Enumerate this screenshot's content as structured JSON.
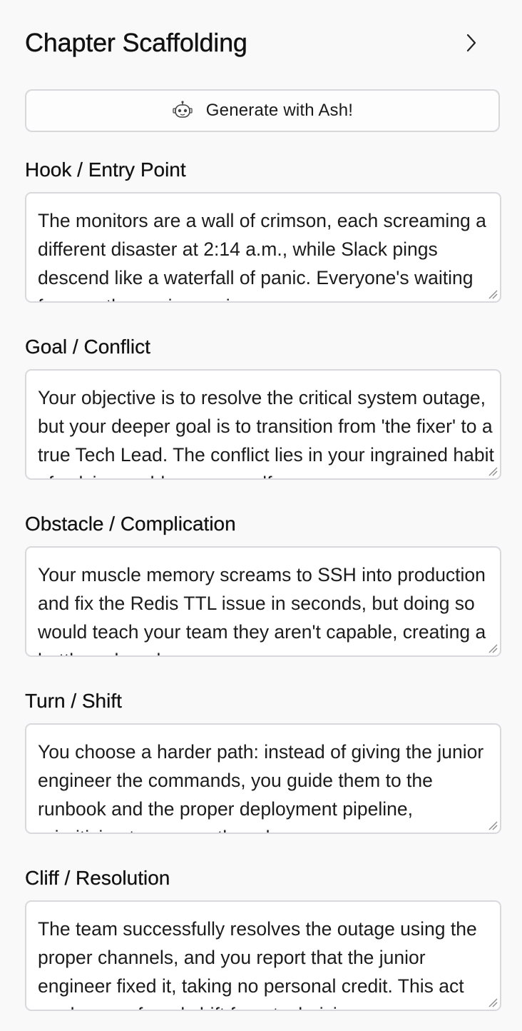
{
  "panel": {
    "title": "Chapter Scaffolding",
    "chevron_icon": "chevron-right-icon",
    "generate_button": {
      "label": "Generate with Ash!",
      "icon": "robot-icon"
    }
  },
  "sections": [
    {
      "label": "Hook / Entry Point",
      "value": "The monitors are a wall of crimson, each screaming a different disaster at 2:14 a.m., while Slack pings descend like a waterfall of panic. Everyone's waiting for you, the senior engineer"
    },
    {
      "label": "Goal / Conflict",
      "value": "Your objective is to resolve the critical system outage, but your deeper goal is to transition from 'the fixer' to a true Tech Lead. The conflict lies in your ingrained habit of solving problems yourself"
    },
    {
      "label": "Obstacle / Complication",
      "value": "Your muscle memory screams to SSH into production and fix the Redis TTL issue in seconds, but doing so would teach your team they aren't capable, creating a bottleneck and"
    },
    {
      "label": "Turn / Shift",
      "value": "You choose a harder path: instead of giving the junior engineer the commands, you guide them to the runbook and the proper deployment pipeline, prioritizing team growth and process"
    },
    {
      "label": "Cliff / Resolution",
      "value": "The team successfully resolves the outage using the proper channels, and you report that the junior engineer fixed it, taking no personal credit. This act marks a profound shift from technician"
    }
  ]
}
